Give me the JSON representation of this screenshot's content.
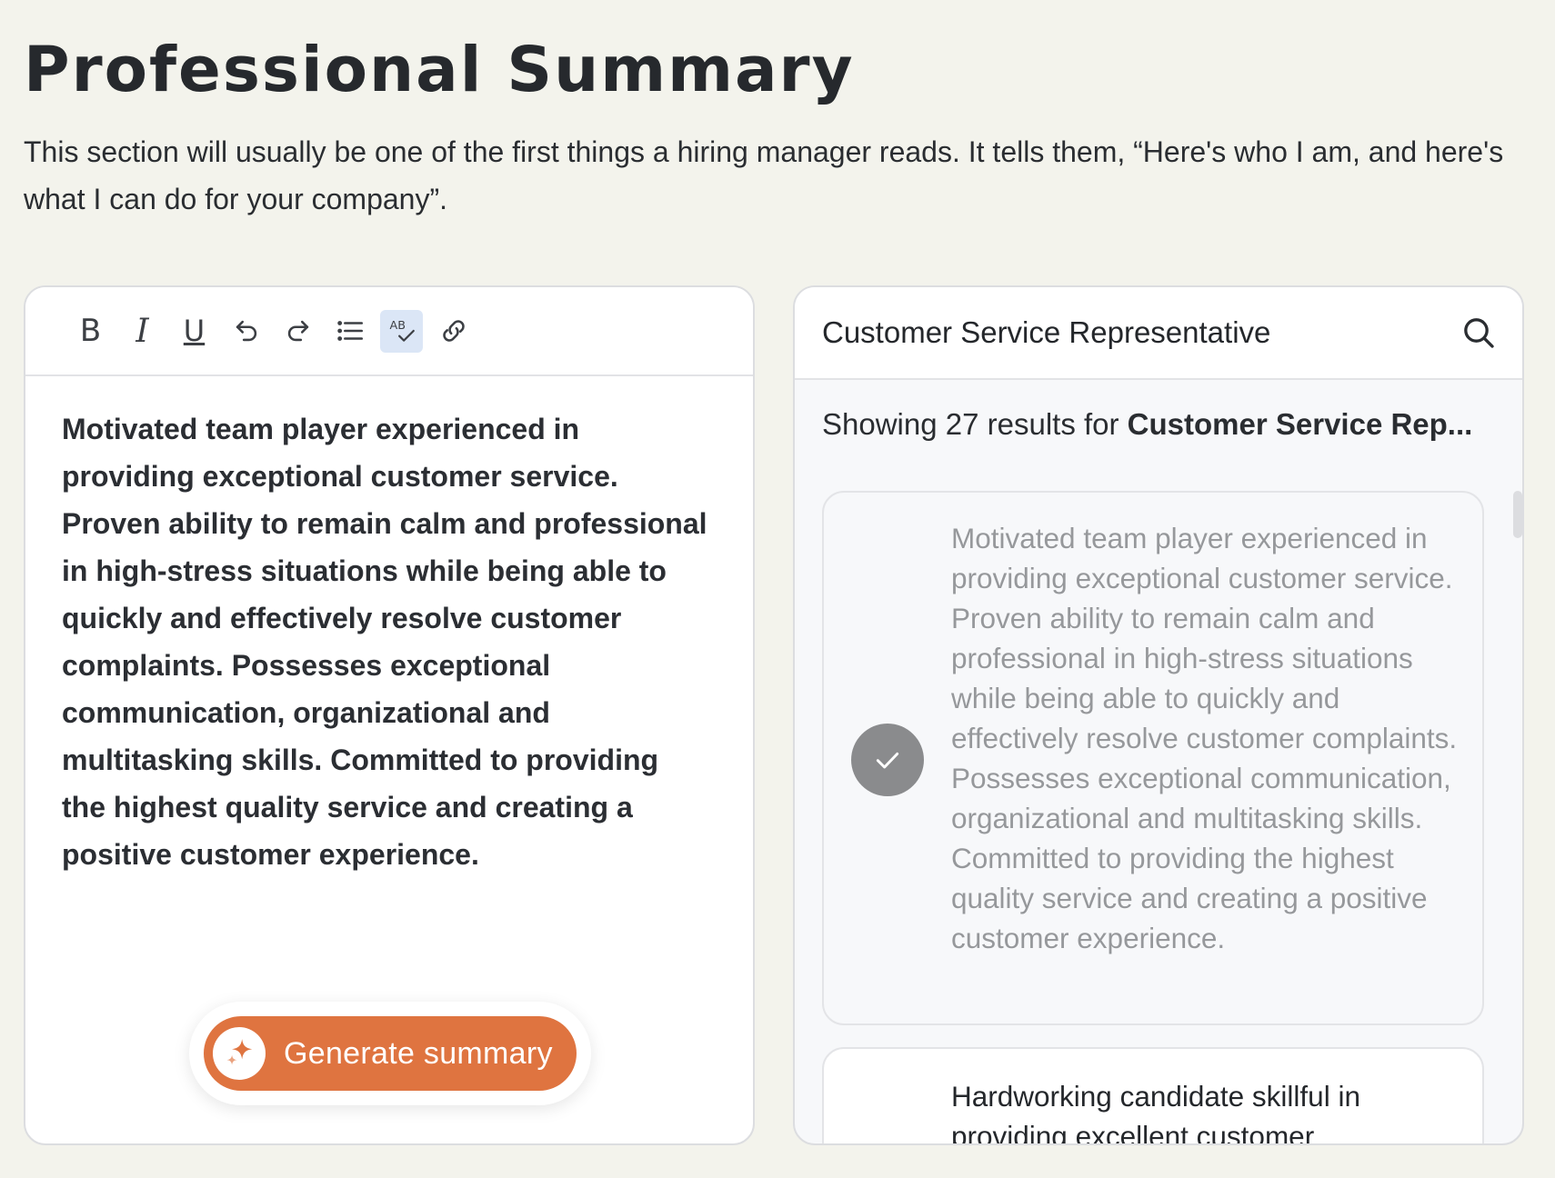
{
  "header": {
    "title": "Professional Summary",
    "description": "This section will usually be one of the first things a hiring manager reads. It tells them, “Here's who I am, and here's what I can do for your company”."
  },
  "editor": {
    "toolbar": [
      {
        "name": "bold-button",
        "icon": "bold-icon",
        "glyph": "B"
      },
      {
        "name": "italic-button",
        "icon": "italic-icon",
        "glyph": "I"
      },
      {
        "name": "underline-button",
        "icon": "underline-icon",
        "glyph": "U"
      },
      {
        "name": "undo-button",
        "icon": "undo-icon"
      },
      {
        "name": "redo-button",
        "icon": "redo-icon"
      },
      {
        "name": "bullet-list-button",
        "icon": "list-icon"
      },
      {
        "name": "spellcheck-button",
        "icon": "spellcheck-icon",
        "glyph": "AB",
        "active": true
      },
      {
        "name": "link-button",
        "icon": "link-icon"
      }
    ],
    "content": "Motivated team player experienced in providing exceptional customer service. Proven ability to remain calm and professional in high-stress situations while being able to quickly and effectively resolve customer complaints. Possesses exceptional communication, organizational and multitasking skills. Committed to providing the highest quality service and creating a positive customer experience.",
    "generate_label": "Generate summary",
    "generate_icon": "sparkle-icon"
  },
  "examples": {
    "search_value": "Customer Service Representative",
    "search_icon": "search-icon",
    "results_prefix": "Showing 27 results for ",
    "results_query": "Customer Service Rep...",
    "cards": [
      {
        "text": "Motivated team player experienced in providing exceptional customer service. Proven ability to remain calm and professional in high-stress situations while being able to quickly and effectively resolve customer complaints. Possesses exceptional communication, organizational and multitasking skills. Committed to providing the highest quality service and creating a positive customer experience.",
        "selected": true,
        "icon": "check-icon"
      },
      {
        "text": "Hardworking candidate skillful in providing excellent customer",
        "selected": false
      }
    ]
  },
  "colors": {
    "background": "#f3f3ec",
    "accent": "#df7440",
    "active_tool": "#dbe6f6",
    "selected_check": "#8a8b8d"
  }
}
